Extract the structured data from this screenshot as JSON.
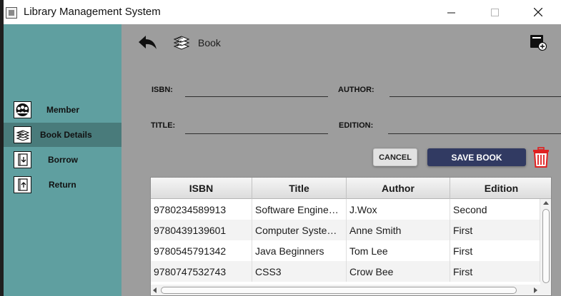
{
  "window": {
    "title": "Library Management System",
    "icons": {
      "app": "app-icon",
      "minimize": "minimize-icon",
      "maximize": "maximize-icon",
      "close": "close-icon"
    }
  },
  "sidebar": {
    "items": [
      {
        "label": "Member",
        "icon": "members-group-icon",
        "active": false
      },
      {
        "label": "Book Details",
        "icon": "books-stack-icon",
        "active": true
      },
      {
        "label": "Borrow",
        "icon": "borrow-book-icon",
        "active": false
      },
      {
        "label": "Return",
        "icon": "return-book-icon",
        "active": false
      }
    ]
  },
  "header": {
    "title": "Book",
    "back_icon": "back-arrow-icon",
    "page_icon": "books-stack-icon",
    "add_icon": "add-book-icon"
  },
  "form": {
    "isbn": {
      "label": "ISBN:",
      "value": ""
    },
    "author": {
      "label": "AUTHOR:",
      "value": ""
    },
    "title": {
      "label": "TITLE:",
      "value": ""
    },
    "edition": {
      "label": "EDITION:",
      "value": ""
    }
  },
  "actions": {
    "cancel_label": "CANCEL",
    "save_label": "SAVE BOOK",
    "delete_icon": "trash-icon"
  },
  "table": {
    "columns": [
      "ISBN",
      "Title",
      "Author",
      "Edition"
    ],
    "rows": [
      [
        "9780234589913",
        "Software Engine…",
        "J.Wox",
        "Second"
      ],
      [
        "9780439139601",
        "Computer Syste…",
        "Anne Smith",
        "First"
      ],
      [
        "9780545791342",
        "Java Beginners",
        "Tom Lee",
        "First"
      ],
      [
        "9780747532743",
        "CSS3",
        "Crow Bee",
        "First"
      ]
    ]
  },
  "colors": {
    "sidebar": "#5f9fa0",
    "sidebar_active": "#497b7b",
    "content": "#9d9d9d",
    "save_button": "#313a62",
    "delete": "#e02020"
  }
}
